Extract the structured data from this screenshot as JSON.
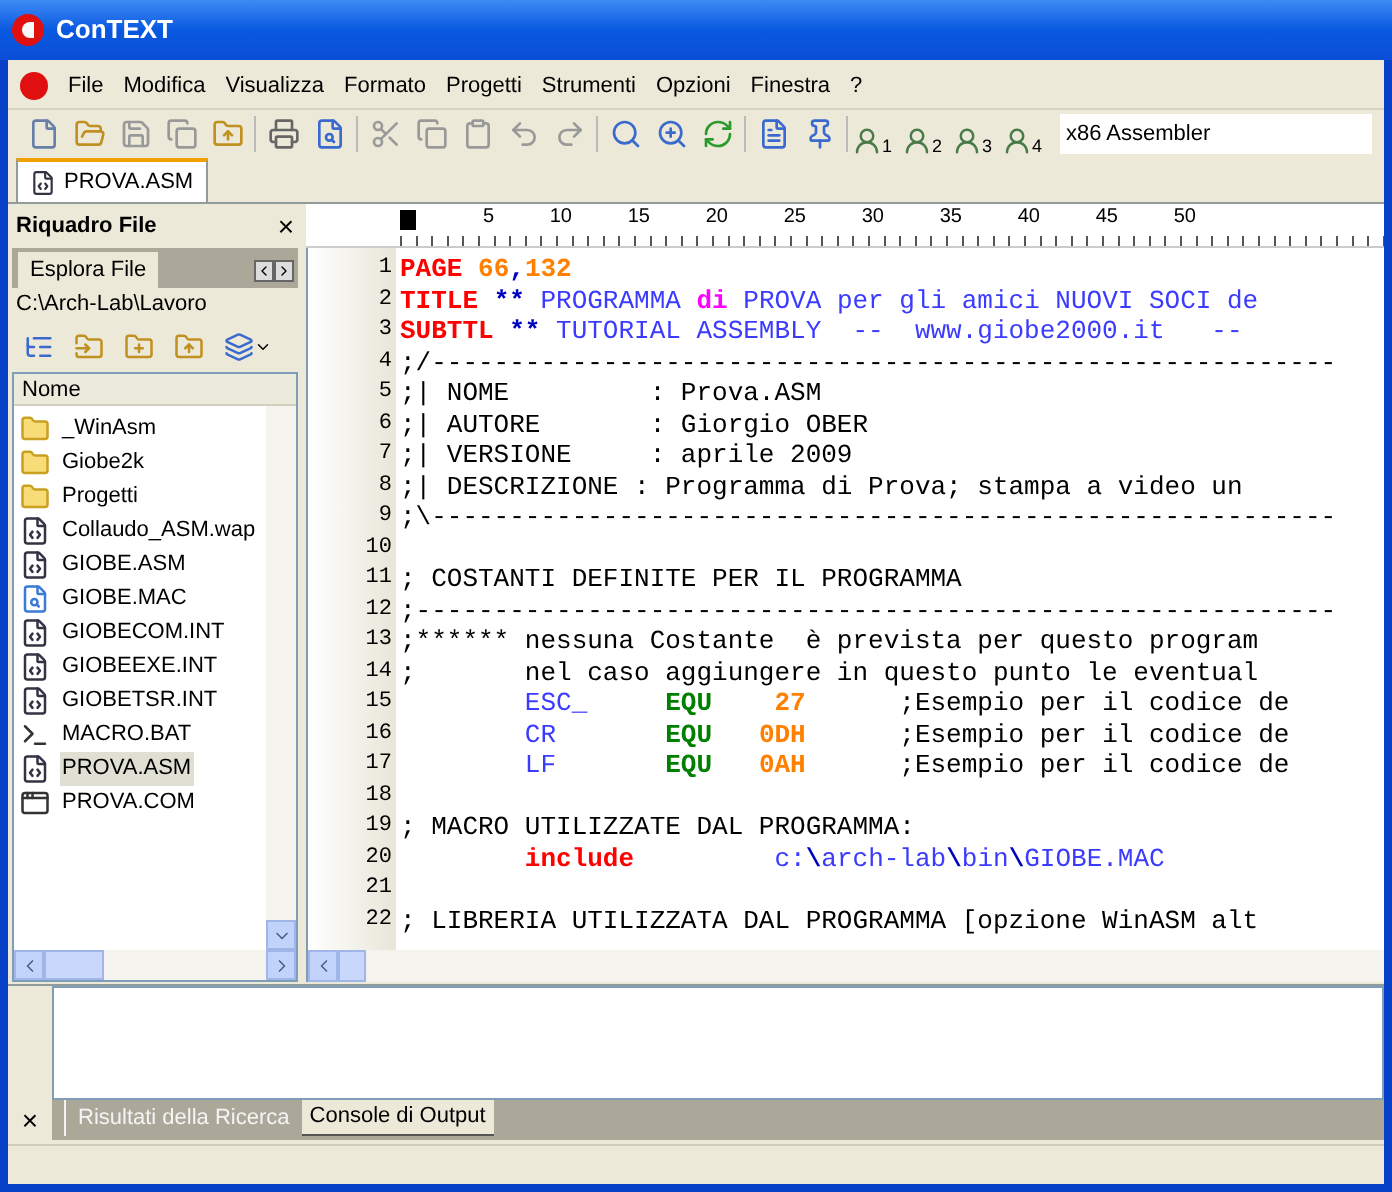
{
  "window": {
    "title": "ConTEXT"
  },
  "menu": [
    "File",
    "Modifica",
    "Visualizza",
    "Formato",
    "Progetti",
    "Strumenti",
    "Opzioni",
    "Finestra",
    "?"
  ],
  "toolbar": {
    "user_tools": [
      "1",
      "2",
      "3",
      "4"
    ],
    "highlighter": "x86 Assembler"
  },
  "doc_tabs": [
    {
      "label": "PROVA.ASM",
      "selected": true
    }
  ],
  "file_panel": {
    "title": "Riquadro File",
    "close": "×",
    "tabs": [
      {
        "label": "Esplora File",
        "selected": true
      }
    ],
    "path": "C:\\Arch-Lab\\Lavoro",
    "column": "Nome",
    "files": [
      {
        "name": "_WinAsm",
        "kind": "folder",
        "selected": false
      },
      {
        "name": "Giobe2k",
        "kind": "folder",
        "selected": false
      },
      {
        "name": "Progetti",
        "kind": "folder",
        "selected": false
      },
      {
        "name": "Collaudo_ASM.wap",
        "kind": "source",
        "selected": false
      },
      {
        "name": "GIOBE.ASM",
        "kind": "source",
        "selected": false
      },
      {
        "name": "GIOBE.MAC",
        "kind": "document",
        "selected": false
      },
      {
        "name": "GIOBECOM.INT",
        "kind": "source",
        "selected": false
      },
      {
        "name": "GIOBEEXE.INT",
        "kind": "source",
        "selected": false
      },
      {
        "name": "GIOBETSR.INT",
        "kind": "source",
        "selected": false
      },
      {
        "name": "MACRO.BAT",
        "kind": "batch",
        "selected": false
      },
      {
        "name": "PROVA.ASM",
        "kind": "source",
        "selected": true
      },
      {
        "name": "PROVA.COM",
        "kind": "program",
        "selected": false
      }
    ]
  },
  "editor": {
    "ruler": [
      "5",
      "10",
      "15",
      "20",
      "25",
      "30",
      "35",
      "40",
      "45",
      "50"
    ],
    "lines": [
      {
        "number": "1",
        "segments": [
          {
            "t": "PAGE ",
            "kind": "directive"
          },
          {
            "t": "66",
            "kind": "number"
          },
          {
            "t": ",",
            "kind": "stars"
          },
          {
            "t": "132",
            "kind": "number"
          }
        ]
      },
      {
        "number": "2",
        "segments": [
          {
            "t": "TITLE ",
            "kind": "directive"
          },
          {
            "t": "** ",
            "kind": "stars"
          },
          {
            "t": "PROGRAMMA ",
            "kind": "text"
          },
          {
            "t": "di ",
            "kind": "magenta"
          },
          {
            "t": "PROVA per gli amici NUOVI SOCI de",
            "kind": "text"
          }
        ]
      },
      {
        "number": "3",
        "segments": [
          {
            "t": "SUBTTL ",
            "kind": "directive"
          },
          {
            "t": "** ",
            "kind": "stars"
          },
          {
            "t": "TUTORIAL ASSEMBLY  --  www.giobe2000.it   --",
            "kind": "text"
          }
        ]
      },
      {
        "number": "4",
        "segments": [
          {
            "t": ";/----------------------------------------------------------",
            "kind": "comment"
          }
        ]
      },
      {
        "number": "5",
        "segments": [
          {
            "t": ";| NOME         : Prova.ASM",
            "kind": "comment"
          }
        ]
      },
      {
        "number": "6",
        "segments": [
          {
            "t": ";| AUTORE       : Giorgio OBER",
            "kind": "comment"
          }
        ]
      },
      {
        "number": "7",
        "segments": [
          {
            "t": ";| VERSIONE     : aprile 2009",
            "kind": "comment"
          }
        ]
      },
      {
        "number": "8",
        "segments": [
          {
            "t": ";| DESCRIZIONE : Programma di Prova; stampa a video un",
            "kind": "comment"
          }
        ]
      },
      {
        "number": "9",
        "segments": [
          {
            "t": ";\\----------------------------------------------------------",
            "kind": "comment"
          }
        ]
      },
      {
        "number": "10"
      },
      {
        "number": "11",
        "segments": [
          {
            "t": "; COSTANTI DEFINITE PER IL PROGRAMMA",
            "kind": "comment"
          }
        ]
      },
      {
        "number": "12",
        "segments": [
          {
            "t": ";-----------------------------------------------------------",
            "kind": "comment"
          }
        ]
      },
      {
        "number": "13",
        "segments": [
          {
            "t": ";****** nessuna Costante  è prevista per questo program",
            "kind": "comment"
          }
        ]
      },
      {
        "number": "14",
        "segments": [
          {
            "t": ";       nel caso aggiungere in questo punto le eventual",
            "kind": "comment"
          }
        ]
      },
      {
        "number": "15",
        "segments": [
          {
            "t": "        ESC_     ",
            "kind": "ident"
          },
          {
            "t": "EQU    ",
            "kind": "equ"
          },
          {
            "t": "27      ",
            "kind": "number"
          },
          {
            "t": ";Esempio per il codice de",
            "kind": "comment"
          }
        ]
      },
      {
        "number": "16",
        "segments": [
          {
            "t": "        CR       ",
            "kind": "ident"
          },
          {
            "t": "EQU   ",
            "kind": "equ"
          },
          {
            "t": "0DH      ",
            "kind": "number"
          },
          {
            "t": ";Esempio per il codice de",
            "kind": "comment"
          }
        ]
      },
      {
        "number": "17",
        "segments": [
          {
            "t": "        LF       ",
            "kind": "ident"
          },
          {
            "t": "EQU   ",
            "kind": "equ"
          },
          {
            "t": "0AH      ",
            "kind": "number"
          },
          {
            "t": ";Esempio per il codice de",
            "kind": "comment"
          }
        ]
      },
      {
        "number": "18"
      },
      {
        "number": "19",
        "segments": [
          {
            "t": "; MACRO UTILIZZATE DAL PROGRAMMA:",
            "kind": "comment"
          }
        ]
      },
      {
        "number": "20",
        "segments": [
          {
            "t": "        include",
            "kind": "directive"
          },
          {
            "t": "         c:",
            "kind": "ident"
          },
          {
            "t": "\\",
            "kind": "stars"
          },
          {
            "t": "arch-lab",
            "kind": "ident"
          },
          {
            "t": "\\",
            "kind": "stars"
          },
          {
            "t": "bin",
            "kind": "ident"
          },
          {
            "t": "\\",
            "kind": "stars"
          },
          {
            "t": "GIOBE.MAC",
            "kind": "ident"
          }
        ]
      },
      {
        "number": "21"
      },
      {
        "number": "22",
        "segments": [
          {
            "t": "; LIBRERIA UTILIZZATA DAL PROGRAMMA [opzione WinASM alt",
            "kind": "comment"
          }
        ]
      }
    ]
  },
  "output_panel": {
    "close": "×",
    "tabs": [
      {
        "label": "Risultati della Ricerca",
        "selected": false
      },
      {
        "label": "Console di Output",
        "selected": true
      }
    ]
  }
}
